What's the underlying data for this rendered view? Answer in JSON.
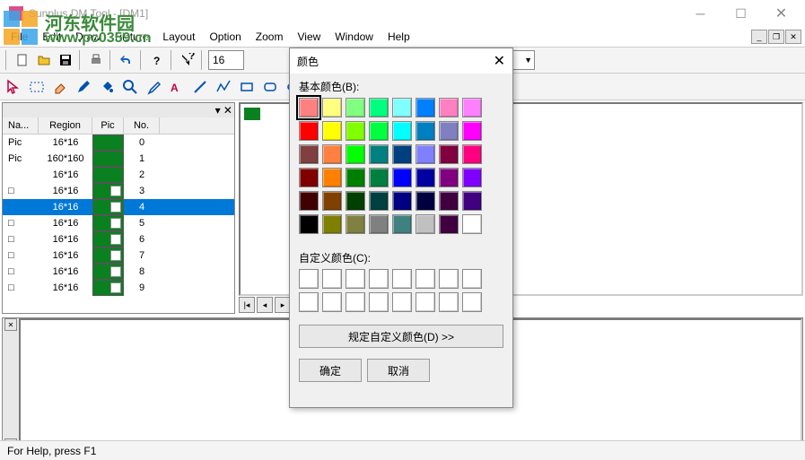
{
  "window": {
    "title": "Sunplus DM Tool - [DM1]"
  },
  "menu": {
    "file": "File",
    "edit": "Edit",
    "draw": "Draw",
    "picture": "Picture",
    "layout": "Layout",
    "option": "Option",
    "zoom": "Zoom",
    "view": "View",
    "window_m": "Window",
    "help": "Help"
  },
  "toolbar": {
    "zoom_value": "16"
  },
  "watermark": {
    "site_name": "河东软件园",
    "url": "www.pc0359.cn"
  },
  "table": {
    "headers": {
      "na": "Na...",
      "region": "Region",
      "pic": "Pic",
      "no": "No."
    },
    "rows": [
      {
        "na": "Pic",
        "region": "16*16",
        "no": "0",
        "haspic": false,
        "sel": false
      },
      {
        "na": "Pic",
        "region": "160*160",
        "no": "1",
        "haspic": false,
        "sel": false
      },
      {
        "na": "",
        "region": "16*16",
        "no": "2",
        "haspic": false,
        "sel": false
      },
      {
        "na": "□",
        "region": "16*16",
        "no": "3",
        "haspic": true,
        "sel": false
      },
      {
        "na": "",
        "region": "16*16",
        "no": "4",
        "haspic": true,
        "sel": true
      },
      {
        "na": "□",
        "region": "16*16",
        "no": "5",
        "haspic": true,
        "sel": false
      },
      {
        "na": "□",
        "region": "16*16",
        "no": "6",
        "haspic": true,
        "sel": false
      },
      {
        "na": "□",
        "region": "16*16",
        "no": "7",
        "haspic": true,
        "sel": false
      },
      {
        "na": "□",
        "region": "16*16",
        "no": "8",
        "haspic": true,
        "sel": false
      },
      {
        "na": "□",
        "region": "16*16",
        "no": "9",
        "haspic": true,
        "sel": false
      }
    ]
  },
  "statusbar": {
    "help": "For Help, press F1"
  },
  "color_dialog": {
    "title": "颜色",
    "basic_label": "基本颜色(B):",
    "custom_label": "自定义颜色(C):",
    "define_btn": "规定自定义颜色(D) >>",
    "ok": "确定",
    "cancel": "取消",
    "basic_colors": [
      "#ff8080",
      "#ffff80",
      "#80ff80",
      "#00ff80",
      "#80ffff",
      "#0080ff",
      "#ff80c0",
      "#ff80ff",
      "#ff0000",
      "#ffff00",
      "#80ff00",
      "#00ff40",
      "#00ffff",
      "#0080c0",
      "#8080c0",
      "#ff00ff",
      "#804040",
      "#ff8040",
      "#00ff00",
      "#008080",
      "#004080",
      "#8080ff",
      "#800040",
      "#ff0080",
      "#800000",
      "#ff8000",
      "#008000",
      "#008040",
      "#0000ff",
      "#0000a0",
      "#800080",
      "#8000ff",
      "#400000",
      "#804000",
      "#004000",
      "#004040",
      "#000080",
      "#000040",
      "#400040",
      "#400080",
      "#000000",
      "#808000",
      "#808040",
      "#808080",
      "#408080",
      "#c0c0c0",
      "#400040",
      "#ffffff"
    ],
    "selected_index": 0
  }
}
